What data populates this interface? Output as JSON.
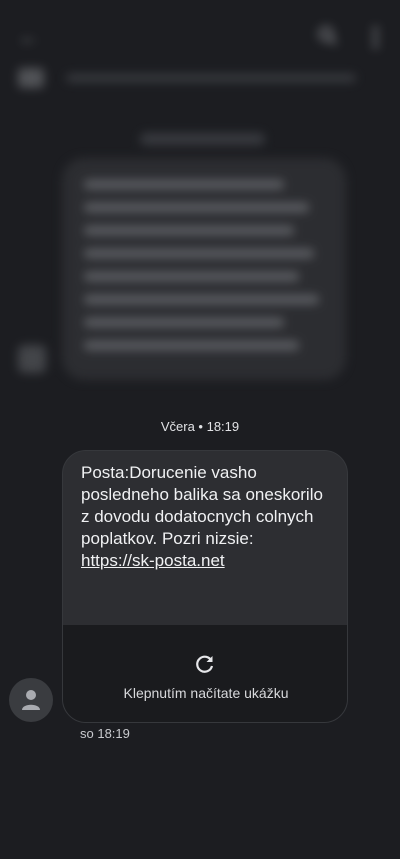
{
  "colors": {
    "background": "#1c1d21",
    "bubble": "#2d2e32",
    "preview_bg": "#1a1b1e",
    "text": "#f0f1f3"
  },
  "header": {
    "back_icon": "arrow-back-icon",
    "search_icon": "search-icon",
    "more_icon": "more-vert-icon"
  },
  "divider": {
    "date": "Včera • 18:19"
  },
  "message": {
    "text": "Posta:Dorucenie vasho posledneho balika sa oneskorilo z dovodu dodatocnych colnych poplatkov. Pozri nizsie: ",
    "link": "https://sk-posta.net",
    "preview_icon": "refresh-icon",
    "preview_label": "Klepnutím načítate ukážku",
    "time": "so 18:19",
    "sender_icon": "person-icon"
  }
}
